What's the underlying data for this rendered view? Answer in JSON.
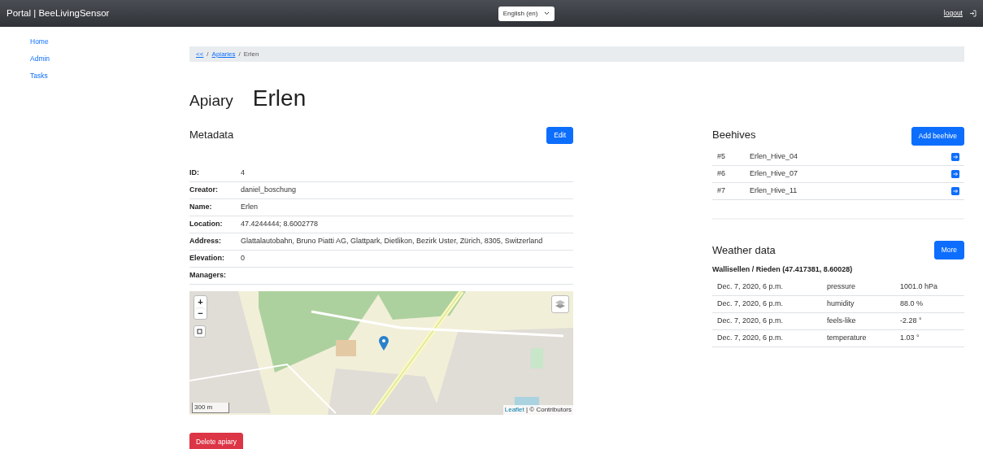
{
  "navbar": {
    "brand": "Portal | BeeLivingSensor",
    "language": "English (en)",
    "logout": "logout"
  },
  "sidebar": {
    "items": [
      "Home",
      "Admin",
      "Tasks"
    ]
  },
  "breadcrumb_separator": "/",
  "breadcrumb": [
    {
      "label": "<<",
      "link": true
    },
    {
      "label": "Apiaries",
      "link": true
    },
    {
      "label": "Erlen",
      "link": false
    }
  ],
  "heading": {
    "label": "Apiary",
    "name": "Erlen"
  },
  "metadata": {
    "title": "Metadata",
    "edit_button": "Edit",
    "rows": [
      {
        "label": "ID:",
        "value": "4"
      },
      {
        "label": "Creator:",
        "value": "daniel_boschung"
      },
      {
        "label": "Name:",
        "value": "Erlen"
      },
      {
        "label": "Location:",
        "value": "47.4244444; 8.6002778"
      },
      {
        "label": "Address:",
        "value": "Glattalautobahn, Bruno Piatti AG, Glattpark, Dietlikon, Bezirk Uster, Zürich, 8305, Switzerland"
      },
      {
        "label": "Elevation:",
        "value": "0"
      },
      {
        "label": "Managers:",
        "value": ""
      }
    ],
    "map": {
      "zoom_in": "+",
      "zoom_out": "−",
      "scale": "300 m",
      "attribution_link": "Leaflet",
      "attribution": "| © Contributors"
    }
  },
  "delete_button": "Delete apiary",
  "beehives": {
    "title": "Beehives",
    "add_button": "Add beehive",
    "rows": [
      {
        "number": "#5",
        "name": "Erlen_Hive_04"
      },
      {
        "number": "#6",
        "name": "Erlen_Hive_07"
      },
      {
        "number": "#7",
        "name": "Erlen_Hive_11"
      }
    ]
  },
  "weather": {
    "title": "Weather data",
    "more_button": "More",
    "station": "Wallisellen / Rieden (47.417381, 8.60028)",
    "rows": [
      {
        "time": "Dec. 7, 2020, 6 p.m.",
        "measure": "pressure",
        "value": "1001.0 hPa"
      },
      {
        "time": "Dec. 7, 2020, 6 p.m.",
        "measure": "humidity",
        "value": "88.0 %"
      },
      {
        "time": "Dec. 7, 2020, 6 p.m.",
        "measure": "feels-like",
        "value": "-2.28 °"
      },
      {
        "time": "Dec. 7, 2020, 6 p.m.",
        "measure": "temperature",
        "value": "1.03 °"
      }
    ]
  }
}
